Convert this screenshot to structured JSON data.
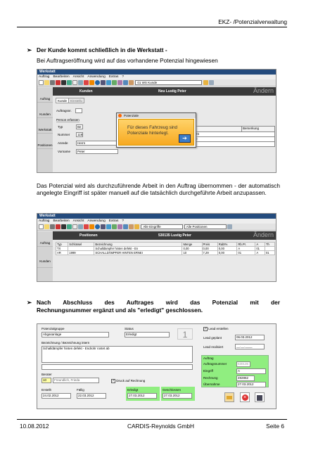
{
  "header": {
    "title": "EKZ- /Potenzialverwaltung"
  },
  "sections": {
    "b1_title": "Der Kunde kommt schließlich in die Werkstatt -",
    "b1_text": "Bei Auftragseröffnung wird auf das vorhandene Potenzial hingewiesen",
    "p2_text": "Das Potenzial wird als durchzuführende Arbeit in den Auftrag übernommen - der automatisch angelegte Eingriff ist später manuell auf die tatsächlich durchgeführte Arbeit anzupassen.",
    "b2_line1": "Nach Abschluss des Auftrages wird das Potenzial mit der",
    "b2_line2": "Rechnungsnummer ergänzt und als \"erledigt\" geschlossen."
  },
  "shot1": {
    "title": "Werkstatt",
    "menu": [
      "Auftrag",
      "Bearbeiten",
      "Ansicht",
      "Anwendung",
      "Extras",
      "?"
    ],
    "toolbar_select": "01 WS Kunde",
    "side": [
      "Auftrag",
      "Kunden",
      "Werkstatt",
      "Positionen"
    ],
    "bar_label": "Kunden",
    "bar_name": "Neu   Lustig Peter",
    "bar_right": "Ändern",
    "tabs": [
      "Kunde",
      "Einstellu"
    ],
    "auftragsnr_label": "Auftragsnr.",
    "person_label": "Person erfassen",
    "rows": [
      {
        "label": "Typ",
        "value": "Be"
      },
      {
        "label": "Nummer",
        "value": "119"
      },
      {
        "label": "Anrede",
        "value": "Herrn"
      },
      {
        "label": "Vorname",
        "value": "Peter"
      }
    ],
    "kredit_label": "Kreditlimi",
    "kredit_value": "0,00",
    "right_head": "Bemerkung",
    "right_rows": [
      "45",
      "0",
      "Handy   0175-1234567"
    ],
    "popup_title": "Potenziale",
    "popup_text": "Für dieses Fahrzeug sind Potenziale hinterlegt."
  },
  "shot2": {
    "title": "Werkstatt",
    "menu": [
      "Auftrag",
      "Bearbeiten",
      "Ansicht",
      "Anwendung",
      "Extras",
      "?"
    ],
    "select1": "Alle Eingriffe",
    "select2": "Alle Positionen",
    "side": [
      "Auftrag",
      "Kunden"
    ],
    "bar_label": "Positionen",
    "bar_name": "530135   Lustig Peter",
    "bar_right": "Ändern",
    "headers": [
      "Typ",
      "Schlüssel",
      "Bezeichnung",
      "Menge",
      "Preis",
      "Rabt%",
      "Rb.Pr.",
      "A",
      "Th"
    ],
    "rows": [
      [
        "TX",
        "",
        "Schalldämpfer hinten defekt - En",
        "0,00",
        "0,00",
        "0,00",
        "A",
        "01",
        ""
      ],
      [
        "AR",
        "1999",
        "SCHALLDÄMPFER HINTEN ERNEI",
        "10",
        "7,29",
        "0,00",
        "01",
        "A",
        "01"
      ]
    ]
  },
  "shot3": {
    "potgruppe_label": "Potenzialgruppe",
    "potgruppe_value": "Abgasanlage",
    "status_label": "Status",
    "status_value": "Erledigt",
    "badge": "1",
    "bez_label": "Bezeichnung / Bezeichnung intern",
    "bez_value": "Schalldämpfer hinten defekt - Endrohr rostet ab",
    "berater_label": "Berater",
    "berater_num": "10",
    "berater_name": "Freundlich, Frieda",
    "druck_label": "Druck auf Rechnung",
    "dates": [
      {
        "label": "Erstellt",
        "value": "24.02.2012"
      },
      {
        "label": "Fällig",
        "value": "22.03.2012"
      },
      {
        "label": "Erledigt",
        "value": "27.03.2012"
      },
      {
        "label": "Geschlossen",
        "value": "27.03.2012"
      }
    ],
    "lead_label": "Lead erstellen",
    "lead_geplant_label": "Lead geplant",
    "lead_geplant_value": "06.03.2012",
    "lead_real_label": "Lead realisiert",
    "lead_real_value": "__.__.____",
    "auftrag_group": "Auftrag",
    "auftrag_rows": [
      {
        "label": "Auftragsnummer",
        "value": "530135"
      },
      {
        "label": "Eingriff",
        "value": "A"
      },
      {
        "label": "Rechnung",
        "value": "492862"
      },
      {
        "label": "Übernahme",
        "value": "27.03.2012"
      }
    ]
  },
  "footer": {
    "date": "10.08.2012",
    "company": "CARDIS-Reynolds GmbH",
    "page": "Seite 6"
  }
}
